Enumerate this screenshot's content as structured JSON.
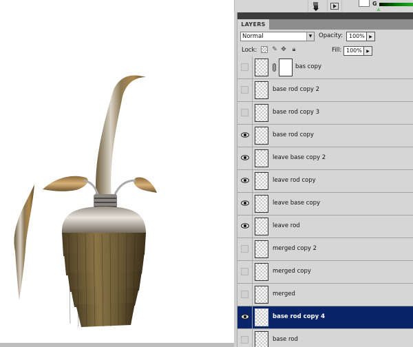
{
  "toolbar": {
    "actions_icon": "actions-icon",
    "play_icon": "play-icon",
    "channel_label": "G"
  },
  "colors": {
    "selected_row": "#0a246a",
    "panel_bg": "#d6d6d6",
    "channel_slider": "#1fae1f"
  },
  "panel": {
    "tab_label": "LAYERS",
    "blend_mode": "Normal",
    "opacity_label": "Opacity:",
    "opacity_value": "100%",
    "lock_label": "Lock:",
    "fill_label": "Fill:",
    "fill_value": "100%"
  },
  "layers": [
    {
      "name": "bas copy",
      "visible": false,
      "selected": false,
      "has_mask": true
    },
    {
      "name": "base rod copy 2",
      "visible": false,
      "selected": false,
      "has_mask": false
    },
    {
      "name": "base rod copy 3",
      "visible": false,
      "selected": false,
      "has_mask": false
    },
    {
      "name": "base rod copy",
      "visible": true,
      "selected": false,
      "has_mask": false
    },
    {
      "name": "leave base copy 2",
      "visible": true,
      "selected": false,
      "has_mask": false
    },
    {
      "name": "leave rod copy",
      "visible": true,
      "selected": false,
      "has_mask": false
    },
    {
      "name": "leave base copy",
      "visible": true,
      "selected": false,
      "has_mask": false
    },
    {
      "name": "leave rod",
      "visible": true,
      "selected": false,
      "has_mask": false
    },
    {
      "name": "merged copy 2",
      "visible": false,
      "selected": false,
      "has_mask": false
    },
    {
      "name": "merged copy",
      "visible": false,
      "selected": false,
      "has_mask": false
    },
    {
      "name": "merged",
      "visible": false,
      "selected": false,
      "has_mask": false
    },
    {
      "name": "base rod copy 4",
      "visible": true,
      "selected": true,
      "has_mask": false
    },
    {
      "name": "base rod",
      "visible": false,
      "selected": false,
      "has_mask": false
    }
  ]
}
